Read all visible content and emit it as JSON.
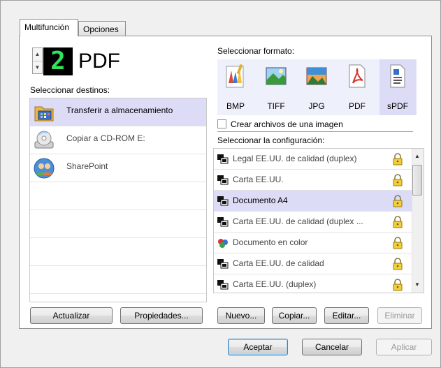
{
  "tabs": [
    {
      "label": "Multifunción",
      "active": true
    },
    {
      "label": "Opciones",
      "active": false
    }
  ],
  "selector": {
    "digit": "2",
    "title": "PDF"
  },
  "destinations": {
    "heading": "Seleccionar destinos:",
    "items": [
      {
        "label": "Transferir a almacenamiento",
        "icon": "storage-folder-icon",
        "selected": true
      },
      {
        "label": "Copiar a CD-ROM  E:",
        "icon": "cd-rom-icon",
        "selected": false
      },
      {
        "label": "SharePoint",
        "icon": "sharepoint-icon",
        "selected": false
      }
    ],
    "buttons": {
      "refresh": "Actualizar",
      "properties": "Propiedades..."
    }
  },
  "format": {
    "heading": "Seleccionar formato:",
    "options": [
      {
        "label": "BMP",
        "icon": "bmp-icon",
        "selected": false
      },
      {
        "label": "TIFF",
        "icon": "tiff-icon",
        "selected": false
      },
      {
        "label": "JPG",
        "icon": "jpg-icon",
        "selected": false
      },
      {
        "label": "PDF",
        "icon": "pdf-icon",
        "selected": false
      },
      {
        "label": "sPDF",
        "icon": "spdf-icon",
        "selected": true
      }
    ],
    "single_image_label": "Crear archivos de una imagen",
    "single_image_checked": false
  },
  "config": {
    "heading": "Seleccionar la configuración:",
    "items": [
      {
        "label": "Legal EE.UU. de calidad (duplex)",
        "icon": "scanner-bw-icon",
        "locked": true,
        "selected": false
      },
      {
        "label": "Carta EE.UU.",
        "icon": "scanner-bw-icon",
        "locked": true,
        "selected": false
      },
      {
        "label": "Documento A4",
        "icon": "scanner-bw-icon",
        "locked": true,
        "selected": true
      },
      {
        "label": "Carta EE.UU. de calidad (duplex ...",
        "icon": "scanner-bw-icon",
        "locked": true,
        "selected": false
      },
      {
        "label": "Documento en color",
        "icon": "scanner-color-icon",
        "locked": true,
        "selected": false
      },
      {
        "label": "Carta EE.UU. de calidad",
        "icon": "scanner-bw-icon",
        "locked": true,
        "selected": false
      },
      {
        "label": "Carta EE.UU. (duplex)",
        "icon": "scanner-bw-icon",
        "locked": true,
        "selected": false
      }
    ],
    "buttons": {
      "new": "Nuevo...",
      "copy": "Copiar...",
      "edit": "Editar...",
      "delete": "Eliminar"
    }
  },
  "footer": {
    "ok": "Aceptar",
    "cancel": "Cancelar",
    "apply": "Aplicar"
  },
  "colors": {
    "selection": "#dcdcf7",
    "digit": "#2fe35a"
  }
}
